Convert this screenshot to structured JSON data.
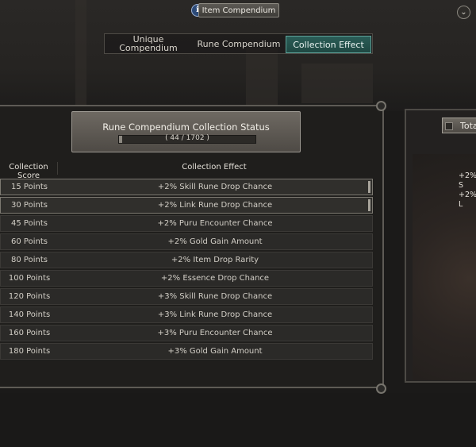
{
  "window": {
    "title": "Item Compendium"
  },
  "tabs": [
    {
      "label": "Unique\nCompendium"
    },
    {
      "label": "Rune Compendium"
    },
    {
      "label": "Collection Effect"
    }
  ],
  "status": {
    "title": "Rune Compendium Collection Status",
    "progress_text": "( 44 / 1702 )",
    "collected": 44,
    "total": 1702
  },
  "table": {
    "headers": {
      "score": "Collection Score",
      "effect": "Collection Effect"
    },
    "rows": [
      {
        "points": "15 Points",
        "effect": "+2% Skill Rune Drop Chance"
      },
      {
        "points": "30 Points",
        "effect": "+2% Link Rune Drop Chance"
      },
      {
        "points": "45 Points",
        "effect": "+2% Puru Encounter Chance"
      },
      {
        "points": "60 Points",
        "effect": "+2% Gold Gain Amount"
      },
      {
        "points": "80 Points",
        "effect": "+2% Item Drop Rarity"
      },
      {
        "points": "100 Points",
        "effect": "+2% Essence Drop Chance"
      },
      {
        "points": "120 Points",
        "effect": "+3% Skill Rune Drop Chance"
      },
      {
        "points": "140 Points",
        "effect": "+3% Link Rune Drop Chance"
      },
      {
        "points": "160 Points",
        "effect": "+3% Puru Encounter Chance"
      },
      {
        "points": "180 Points",
        "effect": "+3% Gold Gain Amount"
      }
    ]
  },
  "right_panel": {
    "tab_label": "Tota",
    "lines": [
      "+2% S",
      "+2% L"
    ]
  },
  "icons": {
    "info": "info-icon",
    "collapse": "chevron-down-icon"
  },
  "colors": {
    "accent": "#2a5d57",
    "panel": "#1f1e1c"
  }
}
